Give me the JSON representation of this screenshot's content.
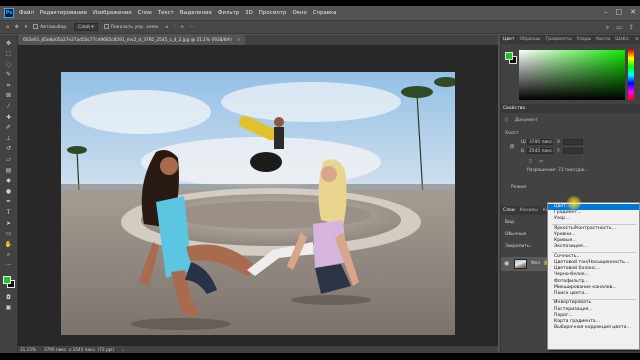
{
  "menubar": {
    "logo": "Ps",
    "items": [
      "Файл",
      "Редактирование",
      "Изображение",
      "Слои",
      "Текст",
      "Выделение",
      "Фильтр",
      "3D",
      "Просмотр",
      "Окно",
      "Справка"
    ],
    "window_controls": [
      "–",
      "□",
      "✕"
    ]
  },
  "options_bar": {
    "autoselect_label": "Автовыбор:",
    "autoselect_value": "Слой",
    "transform_label": "Показать упр. элем."
  },
  "document": {
    "tab_title": "602e61_85e8a05a27e27ad50c77cd9665c8591_mv2_d_3795_2545_s_4_2.jpg @ 31,1% (RGB/8#)",
    "close": "×"
  },
  "status": {
    "zoom": "31,15%",
    "size": "3795 пикс. x 2545 пикс. (72 ppi)"
  },
  "color_panel": {
    "tabs": [
      "Цвет",
      "Образцы",
      "Градиенты",
      "Узоры",
      "Кисти",
      "Шабл."
    ],
    "active_tab": "Цвет",
    "foreground": "#1fc61f",
    "background": "#111111"
  },
  "properties_panel": {
    "title": "Свойства",
    "doc_label": "Документ",
    "canvas_label": "Холст",
    "width_label": "Ш",
    "width_value": "3795 пикс.",
    "height_label": "В",
    "height_value": "2545 пикс.",
    "x_label": "X",
    "y_label": "Y",
    "resolution": "Разрешение: 72 пикс/дю...",
    "mode": "Режим"
  },
  "layers_panel": {
    "tabs": [
      "Слои",
      "Каналы",
      "Контуры"
    ],
    "kind_filter": "Вид",
    "blend_mode": "Обычные",
    "lock_label": "Закрепить:",
    "layer_name": "Фон"
  },
  "adjustments_menu": {
    "items": [
      {
        "label": "Цвет...",
        "highlighted": true
      },
      {
        "label": "Градиент...",
        "highlighted": false
      },
      {
        "label": "Узор...",
        "highlighted": false
      },
      {
        "sep": true
      },
      {
        "label": "Яркость/Контрастность...",
        "highlighted": false
      },
      {
        "label": "Уровни...",
        "highlighted": false
      },
      {
        "label": "Кривые...",
        "highlighted": false
      },
      {
        "label": "Экспозиция...",
        "highlighted": false
      },
      {
        "sep": true
      },
      {
        "label": "Сочность...",
        "highlighted": false
      },
      {
        "label": "Цветовой тон/Насыщенность...",
        "highlighted": false
      },
      {
        "label": "Цветовой баланс...",
        "highlighted": false
      },
      {
        "label": "Черно-белое...",
        "highlighted": false
      },
      {
        "label": "Фотофильтр...",
        "highlighted": false
      },
      {
        "label": "Микширование каналов...",
        "highlighted": false
      },
      {
        "label": "Поиск цвета...",
        "highlighted": false
      },
      {
        "sep": true
      },
      {
        "label": "Инвертировать",
        "highlighted": false
      },
      {
        "label": "Постеризация...",
        "highlighted": false
      },
      {
        "label": "Порог...",
        "highlighted": false
      },
      {
        "label": "Карта градиента...",
        "highlighted": false
      },
      {
        "label": "Выборочная коррекция цвета...",
        "highlighted": false
      }
    ]
  }
}
